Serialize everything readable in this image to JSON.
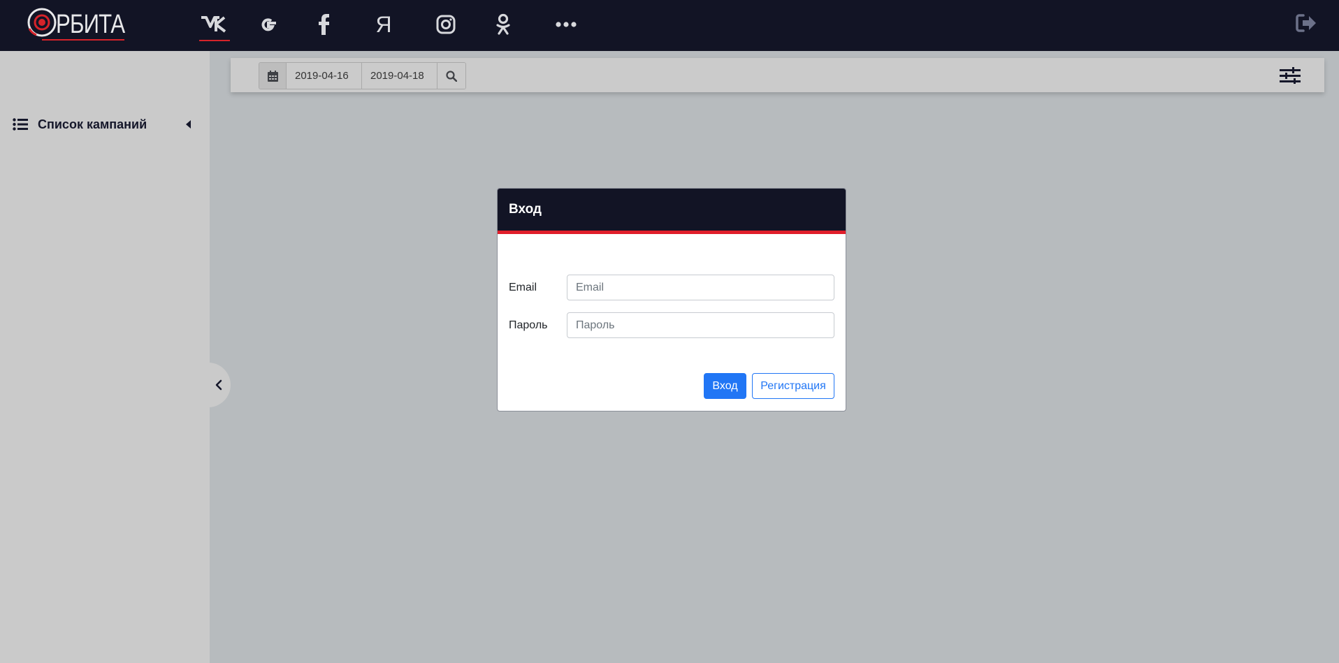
{
  "brand": {
    "logo_text": "РБИТА",
    "accent_color": "#d6232a"
  },
  "topnav": {
    "items": [
      {
        "name": "vk-icon",
        "label": "VK",
        "active": true
      },
      {
        "name": "google-icon",
        "label": "G",
        "active": false
      },
      {
        "name": "facebook-icon",
        "label": "f",
        "active": false
      },
      {
        "name": "yandex-icon",
        "label": "Я",
        "active": false
      },
      {
        "name": "instagram-icon",
        "label": "Instagram",
        "active": false
      },
      {
        "name": "odnoklassniki-icon",
        "label": "OK",
        "active": false
      },
      {
        "name": "more-icon",
        "label": "•••",
        "active": false
      }
    ],
    "logout_icon": "logout-icon"
  },
  "sidebar": {
    "campaigns_label": "Список кампаний",
    "list_icon": "list-icon",
    "collapse_icon": "caret-left-icon",
    "toggle_icon": "chevron-left-icon"
  },
  "toolbar": {
    "date_from": "2019-04-16",
    "date_to": "2019-04-18",
    "calendar_icon": "calendar-icon",
    "search_icon": "search-icon",
    "settings_icon": "sliders-icon"
  },
  "login_modal": {
    "title": "Вход",
    "email_label": "Email",
    "email_placeholder": "Email",
    "email_value": "",
    "password_label": "Пароль",
    "password_placeholder": "Пароль",
    "password_value": "",
    "login_button": "Вход",
    "register_button": "Регистрация",
    "primary_color": "#2176f5",
    "header_color": "#121425",
    "header_border_color": "#e01e2b"
  }
}
